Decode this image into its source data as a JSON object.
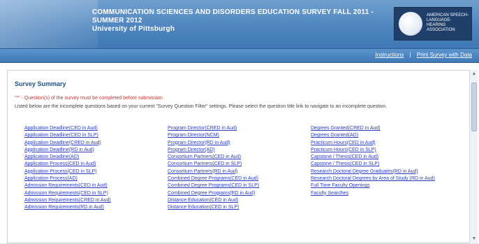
{
  "header": {
    "title_line1": "COMMUNICATION SCIENCES AND DISORDERS EDUCATION SURVEY FALL 2011 -",
    "title_line2": "SUMMER 2012",
    "institution": "University of Pittsburgh",
    "logo_text": "AMERICAN SPEECH-LANGUAGE-HEARING ASSOCIATION"
  },
  "nav": {
    "links": [
      "Instructions",
      "Print Survey with Data"
    ]
  },
  "panel": {
    "title": "Survey Summary",
    "warning": "\"*\" - Question(s) of the survey must be completed before submission",
    "description": "Listed below are the incomplete questions based on your current \"Survey Question Filter\" settings. Please select the question title link to navigate to an incomplete question."
  },
  "columns": {
    "c1": [
      "Application Deadline(CED in Aud)",
      "Application Deadline(CED in SLP)",
      "Application Deadline(CRED in Aud)",
      "Application Deadline(RD in Aud)",
      "Application Deadline(AD)",
      "Application Process(CED in Aud)",
      "Application Process(CED in SLP)",
      "Application Process(AD)",
      "Admission Requirements(CED in Aud)",
      "Admission Requirements(CED in SLP)",
      "Admission Requirements(CRED in Aud)",
      "Admission Requirements(RD in Aud)"
    ],
    "c2": [
      "Program Director(CRED in Aud)",
      "Program Director(NCM)",
      "Program Director(RD in Aud)",
      "Program Director(AD)",
      "Consortium Partners(CED in Aud)",
      "Consortium Partners(CED in SLP)",
      "Consortium Partners(RD in Aud)",
      "Combined Degree Programs(CED in Aud)",
      "Combined Degree Programs(CED in SLP)",
      "Combined Degree Programs(RD in Aud)",
      "Distance Education(CED in Aud)",
      "Distance Education(CED in SLP)"
    ],
    "c3": [
      "Degrees Granted(CRED in Aud)",
      "Degrees Granted(AD)",
      "Practicum Hours(CED in Aud)",
      "Practicum Hours(CED in SLP)",
      "Capstone / Thesis(CED in Aud)",
      "Capstone / Thesis(CED in SLP)",
      "Research Doctoral Degree Graduates(RD in Aud)",
      "Research Doctoral Degrees by Area of Study (RD in Aud)",
      "Full Time Faculty Openings",
      "Faculty Searches"
    ]
  },
  "colors": {
    "banner": "#4f86bf",
    "link": "#2a3bbf",
    "warning": "#c23434",
    "title": "#1f4f86"
  }
}
